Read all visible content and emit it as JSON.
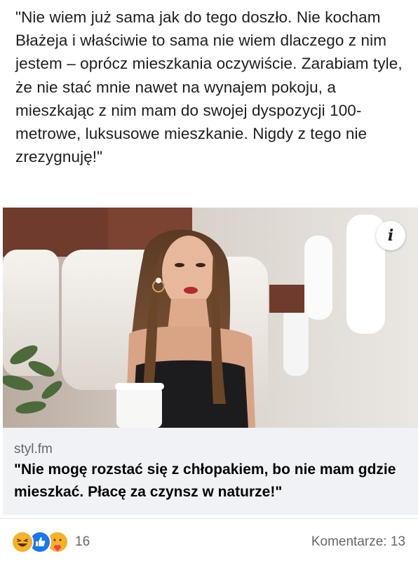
{
  "post": {
    "text": "\"Nie wiem już sama jak do tego doszło. Nie kocham Błażeja i właściwie to sama nie wiem dlaczego z nim jestem – oprócz mieszkania oczywiście. Zarabiam tyle, że nie stać mnie nawet na wynajem pokoju, a mieszkając z nim mam do swojej dyspozycji 100-metrowe, luksusowe mieszkanie. Nigdy z tego nie zrezygnuję!\""
  },
  "link": {
    "domain": "styl.fm",
    "headline": "\"Nie mogę rozstać się z chłopakiem, bo nie mam gdzie mieszkać. Płacę za czynsz w naturze!\"",
    "info_glyph": "i",
    "image_subject": "woman in a private jet cabin"
  },
  "footer": {
    "reaction_icons": [
      "haha-icon",
      "like-icon",
      "care-icon"
    ],
    "reaction_count": "16",
    "comments_label": "Komentarze: 13"
  },
  "colors": {
    "text": "#1c1e21",
    "secondary": "#65676b",
    "card_bg": "#f0f2f5",
    "like_blue": "#1877f2",
    "reaction_yellow": "#f7b125"
  }
}
